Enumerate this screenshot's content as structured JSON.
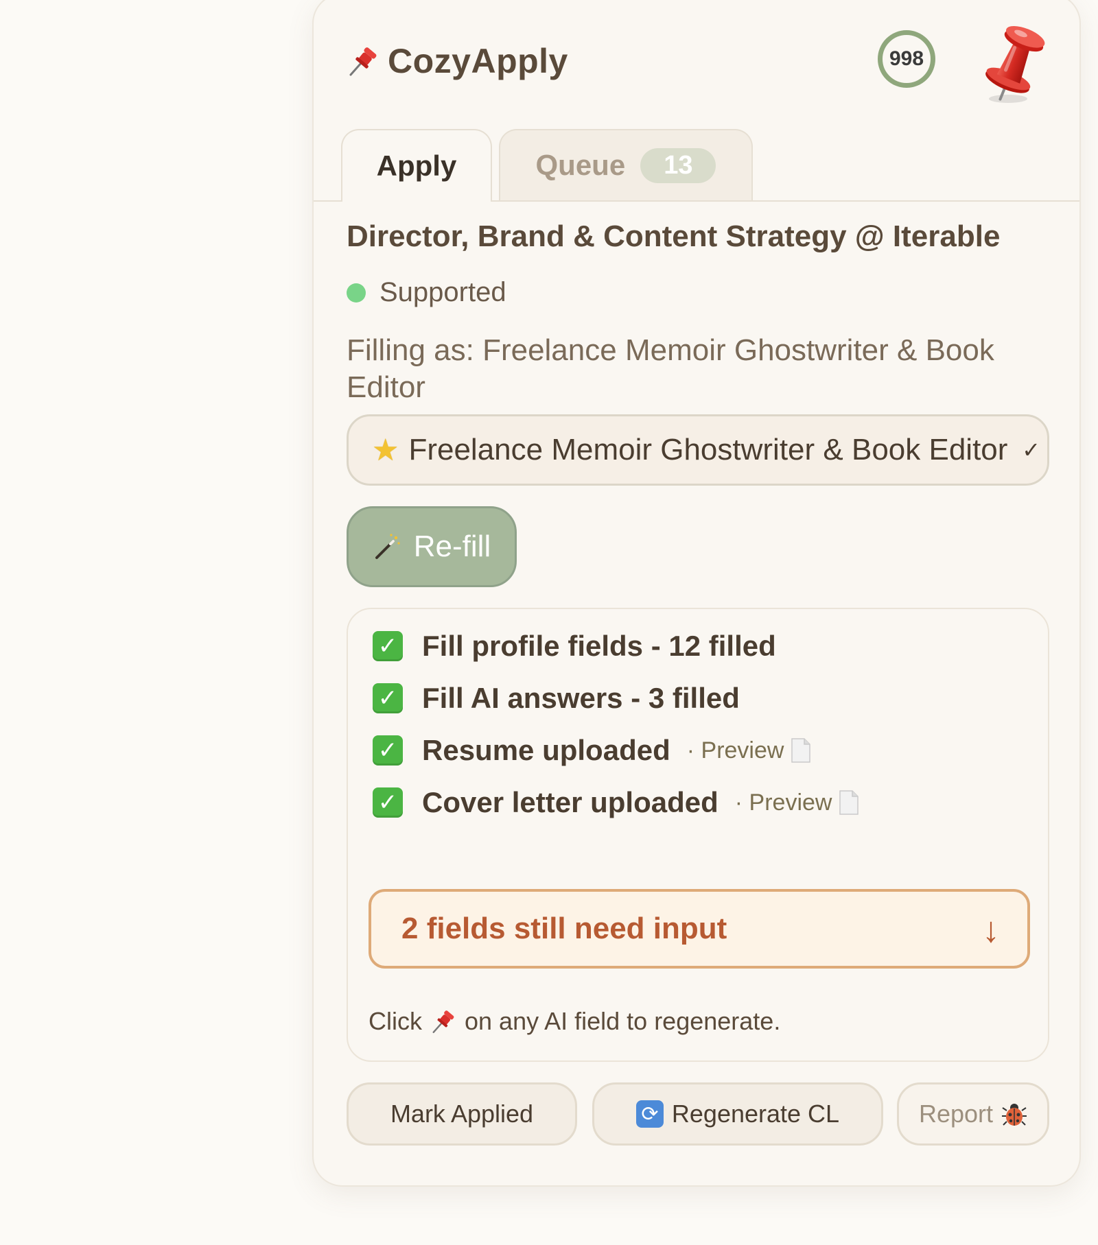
{
  "header": {
    "brand_name": "CozyApply",
    "score": "998"
  },
  "tabs": [
    {
      "label": "Apply",
      "active": true
    },
    {
      "label": "Queue",
      "badge": "13",
      "active": false
    }
  ],
  "job": {
    "title": "Director, Brand & Content Strategy @ Iterable",
    "status": "Supported",
    "filling_as": "Filling as: Freelance Memoir Ghostwriter & Book Editor"
  },
  "profile_select": {
    "value": "Freelance Memoir Ghostwriter & Book Editor"
  },
  "refill_button": {
    "label": "Re-fill"
  },
  "steps": [
    {
      "label": "Fill profile fields - 12 filled",
      "done": true
    },
    {
      "label": "Fill AI answers - 3 filled",
      "done": true
    },
    {
      "label": "Resume uploaded",
      "done": true,
      "preview": "· Preview"
    },
    {
      "label": "Cover letter uploaded",
      "done": true,
      "preview": "· Preview"
    }
  ],
  "needs_input": {
    "label": "2 fields still need input",
    "arrow": "↓"
  },
  "hint": {
    "before": "Click",
    "after": "on any AI field to regenerate."
  },
  "actions": {
    "mark_applied": "Mark Applied",
    "regenerate_cl": "Regenerate CL",
    "report": "Report"
  },
  "colors": {
    "accent_green": "#a6b89b",
    "status_green": "#79d488",
    "warning_orange": "#b75a32",
    "score_ring": "#8fa77c"
  },
  "icons": {
    "brand": "pushpin-icon",
    "mascot": "pushpin-icon",
    "refill": "magic-wand-icon",
    "check": "check-mark-icon",
    "preview": "document-icon",
    "needs_input": "down-arrow-icon",
    "hint": "pushpin-icon",
    "regenerate": "refresh-icon",
    "report": "ladybug-icon",
    "select": "star-icon"
  }
}
